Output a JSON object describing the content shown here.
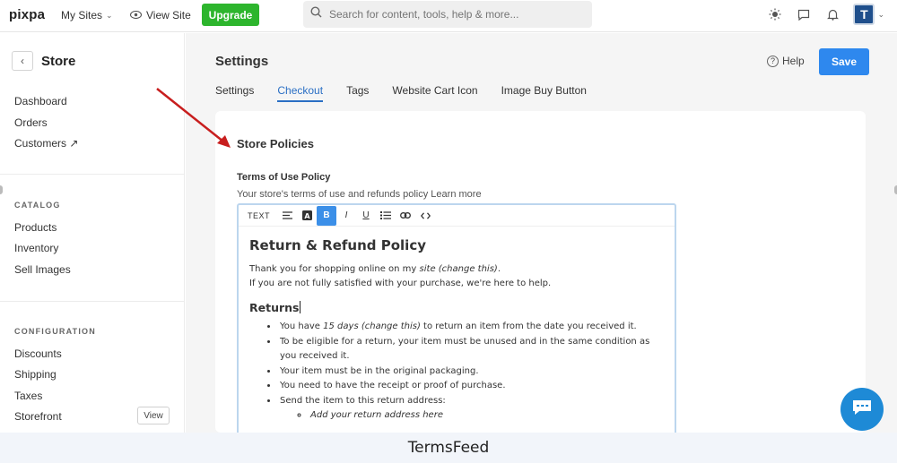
{
  "topbar": {
    "logo": "pixpa",
    "my_sites": "My Sites",
    "view_site": "View Site",
    "upgrade": "Upgrade",
    "search_placeholder": "Search for content, tools, help & more...",
    "avatar_letter": "T"
  },
  "sidebar": {
    "back_icon": "chevron-left-icon",
    "title": "Store",
    "top_items": [
      "Dashboard",
      "Orders",
      "Customers ↗"
    ],
    "catalog_label": "CATALOG",
    "catalog_items": [
      "Products",
      "Inventory",
      "Sell Images"
    ],
    "config_label": "CONFIGURATION",
    "config_items": [
      "Discounts",
      "Shipping",
      "Taxes",
      "Storefront"
    ],
    "storefront_view": "View"
  },
  "main": {
    "title": "Settings",
    "help": "Help",
    "save": "Save",
    "tabs": [
      {
        "label": "Settings",
        "active": false
      },
      {
        "label": "Checkout",
        "active": true
      },
      {
        "label": "Tags",
        "active": false
      },
      {
        "label": "Website Cart Icon",
        "active": false
      },
      {
        "label": "Image Buy Button",
        "active": false
      }
    ],
    "card": {
      "title": "Store Policies",
      "field_label": "Terms of Use Policy",
      "field_help": "Your store's terms of use and refunds policy Learn more",
      "toolbar": {
        "text_label": "TEXT",
        "align_icon": "align-left-icon",
        "color_icon": "text-color-icon",
        "bold": "B",
        "italic": "I",
        "underline": "U",
        "list_icon": "list-icon",
        "link_icon": "link-icon",
        "code_icon": "code-icon"
      },
      "editor": {
        "heading": "Return & Refund Policy",
        "p1_a": "Thank you for shopping online on my ",
        "p1_b": "site (change this)",
        "p1_c": ".",
        "p2": "If you are not fully satisfied with your purchase, we're here to help.",
        "h2": "Returns",
        "li1_a": "You have ",
        "li1_b": "15 days (change this)",
        "li1_c": " to return an item from the date you received it.",
        "li2": "To be eligible for a return, your item must be unused and in the same condition as you received it.",
        "li3": "Your item must be in the original packaging.",
        "li4": "You need to have the receipt or proof of purchase.",
        "li5": "Send the item to this return address:",
        "sub1": "Add your return address here"
      }
    }
  },
  "footer": "TermsFeed",
  "colors": {
    "accent": "#2e88ee",
    "upgrade": "#2db52d",
    "annotation_arrow": "#c81e1e",
    "chat": "#1e8ad6"
  }
}
